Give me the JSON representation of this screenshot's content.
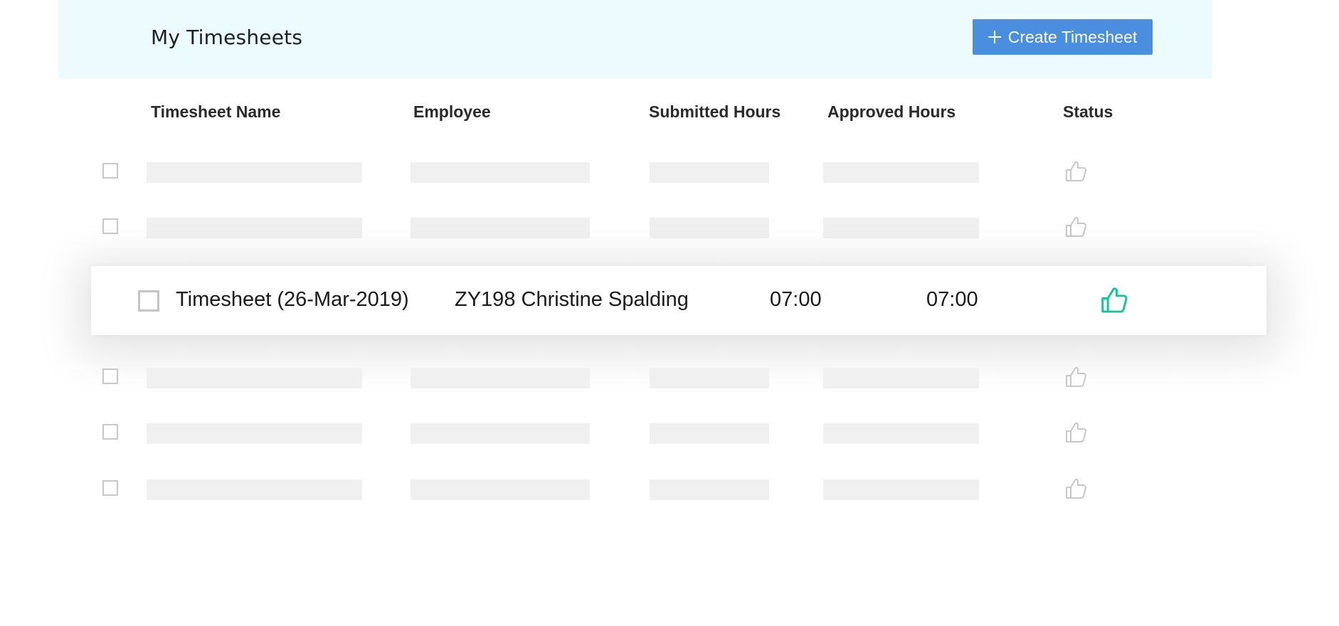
{
  "header": {
    "title": "My Timesheets",
    "create_button": "Create Timesheet"
  },
  "columns": {
    "name": "Timesheet Name",
    "employee": "Employee",
    "submitted": "Submitted Hours",
    "approved": "Approved Hours",
    "status": "Status"
  },
  "highlighted_row": {
    "name": "Timesheet (26-Mar-2019)",
    "employee": "ZY198 Christine Spalding",
    "submitted_hours": "07:00",
    "approved_hours": "07:00",
    "status_icon": "thumbs-up-icon"
  },
  "colors": {
    "header_bg": "#ebfbfe",
    "button_bg": "#4a8ee0",
    "approved_green": "#1fbf9a",
    "placeholder_gray": "#f0f0f0"
  }
}
